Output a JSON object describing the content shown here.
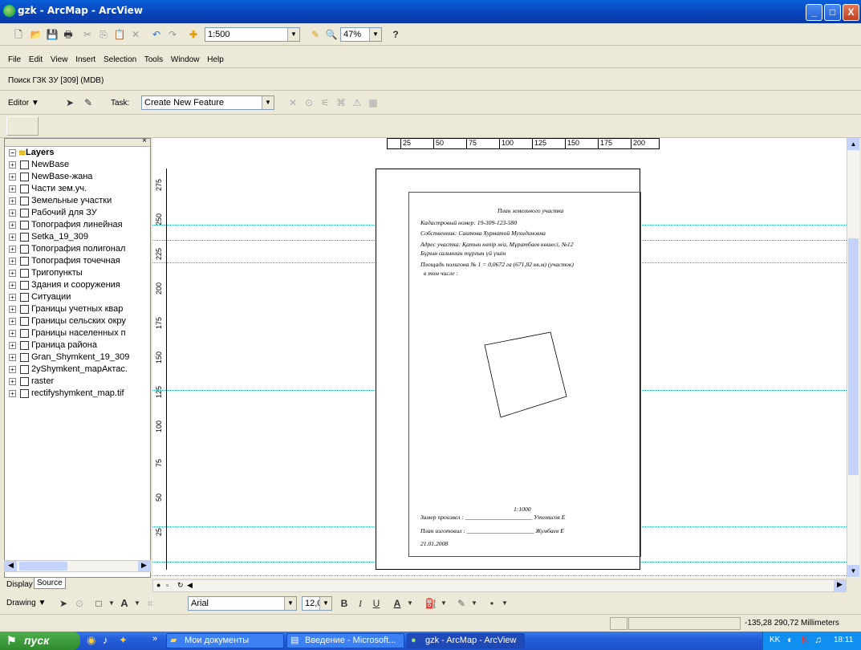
{
  "window": {
    "title": "gzk - ArcMap - ArcView",
    "minimize": "_",
    "maximize": "□",
    "close": "X"
  },
  "toolbar": {
    "scale": "1:500",
    "zoom": "47%"
  },
  "menu": {
    "items": [
      "File",
      "Edit",
      "View",
      "Insert",
      "Selection",
      "Tools",
      "Window",
      "Help"
    ]
  },
  "search_bar": {
    "text": "Поиск  ГЗК  ЗУ [309] (MDB)"
  },
  "editor": {
    "label": "Editor ▼",
    "task_label": "Task:",
    "task_value": "Create New Feature"
  },
  "toc": {
    "root": "Layers",
    "layers": [
      "NewBase",
      "NewBase-жана",
      "Части зем.уч.",
      "Земельные участки",
      "Рабочий для ЗУ",
      "Топография линейная",
      "Setka_19_309",
      "Топография полигонал",
      "Топография точечная",
      "Тригопункты",
      "Здания и сооружения",
      "Ситуации",
      "Границы учетных квар",
      "Границы сельских окру",
      "Границы населенных п",
      "Граница района",
      "Gran_Shymkent_19_309",
      "2yShymkent_mapАктас.",
      "raster",
      "rectifyshymkent_map.tif"
    ],
    "tabs": [
      "Display",
      "Source"
    ]
  },
  "ruler": {
    "top": [
      "25",
      "50",
      "75",
      "100",
      "125",
      "150",
      "175",
      "200"
    ],
    "left": [
      "275",
      "250",
      "225",
      "200",
      "175",
      "150",
      "125",
      "100",
      "75",
      "50",
      "25"
    ]
  },
  "plan": {
    "title": "План земельного участка",
    "line1": "Кадастровый номер: 19-309-123-580",
    "line2": "Собственник: Саитова Хурматой Мухидиновна",
    "line3": "Адрес участка: Қатын көпір м/а, Мұратбаев көшесі, №12",
    "line4": "Бұрын салынған тұрғын үй үшін",
    "line5": "Площадь полигона № 1 = 0,0672 га (671,82 кв.м) (участок)",
    "line6": "в том числе :",
    "scale": "1:1000",
    "meas": "Замер произвел : ______________________ Утемисов Е",
    "made": "План изготовил : ______________________ Жумбаев Е",
    "date": "21.01.2008"
  },
  "drawing": {
    "label": "Drawing ▼",
    "font": "Arial",
    "size": "12,0"
  },
  "status": {
    "coords": "-135,28  290,72 Millimeters"
  },
  "taskbar": {
    "start": "пуск",
    "tasks": [
      "Мои документы",
      "Введение - Microsoft...",
      "gzk - ArcMap - ArcView"
    ],
    "lang": "KK",
    "time": "18:11"
  }
}
